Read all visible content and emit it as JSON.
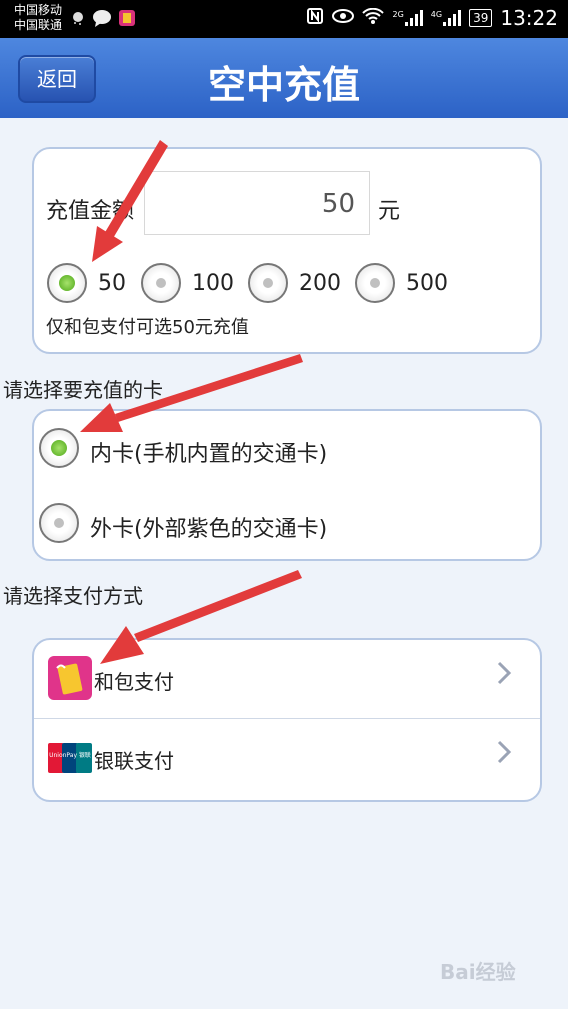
{
  "statusbar": {
    "carrier1": "中国移动",
    "carrier2": "中国联通",
    "net_label_1": "2G",
    "net_label_2": "4G",
    "battery": "39",
    "time": "13:22"
  },
  "header": {
    "back_label": "返回",
    "title": "空中充值"
  },
  "amount": {
    "label": "充值金额",
    "value": "50",
    "unit": "元",
    "options": [
      {
        "label": "50",
        "selected": true
      },
      {
        "label": "100",
        "selected": false
      },
      {
        "label": "200",
        "selected": false
      },
      {
        "label": "500",
        "selected": false
      }
    ],
    "note": "仅和包支付可选50元充值"
  },
  "card_select": {
    "section_label": "请选择要充值的卡",
    "options": [
      {
        "label": "内卡(手机内置的交通卡)",
        "selected": true
      },
      {
        "label": "外卡(外部紫色的交通卡)",
        "selected": false
      }
    ]
  },
  "payment": {
    "section_label": "请选择支付方式",
    "methods": [
      {
        "label": "和包支付",
        "icon": "hebao-icon"
      },
      {
        "label": "银联支付",
        "icon": "unionpay-icon"
      }
    ],
    "unionpay_logo_text": "UnionPay 银联"
  },
  "watermark": "Bai经验",
  "colors": {
    "titlebar": "#3a73d4",
    "card_border": "#b6c8e4",
    "arrow": "#e23b3b",
    "radio_on": "#5cb82a"
  }
}
